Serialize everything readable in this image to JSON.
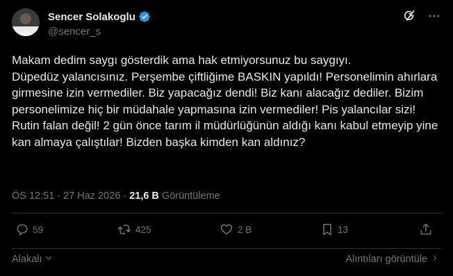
{
  "author": {
    "display_name": "Sencer Solakoglu",
    "handle": "@sencer_s",
    "verified": true
  },
  "tweet": {
    "text": "Makam dedim saygı gösterdik ama hak etmiyorsunuz bu saygıyı.\nDüpedüz yalancısınız. Perşembe çiftliğime BASKIN yapıldı! Personelimin ahırlara girmesine izin vermediler. Biz yapacağız dendi! Biz kanı alacağız dediler. Bizim personelimize hiç bir müdahale yapmasına izin vermediler! Pis yalancılar sizi! Rutin falan değil! 2 gün önce tarım il müdürlüğünün aldığı kanı kabul etmeyip yine kan almaya çalıştılar! Bizden başka kimden kan aldınız?"
  },
  "meta": {
    "time": "ÖS 12:51",
    "separator": "·",
    "date": "27 Haz 2026",
    "views_count": "21,6 B",
    "views_label": "Görüntüleme"
  },
  "actions": {
    "replies": "59",
    "retweets": "425",
    "likes": "2 B",
    "bookmarks": "13"
  },
  "footer": {
    "related_label": "Alakalı",
    "view_interactions_label": "Alıntıları görüntüle"
  },
  "icons": {
    "grok": "grok-icon",
    "more": "more-icon",
    "reply": "reply-icon",
    "retweet": "retweet-icon",
    "like": "heart-icon",
    "bookmark": "bookmark-icon",
    "share": "share-icon",
    "verified": "verified-badge-icon",
    "chevron_down": "chevron-down-icon",
    "chevron_right": "chevron-right-icon"
  },
  "colors": {
    "background": "#000000",
    "text_primary": "#e7e9ea",
    "text_secondary": "#71767b",
    "divider": "#2f3336",
    "verified_blue": "#1d9bf0"
  }
}
